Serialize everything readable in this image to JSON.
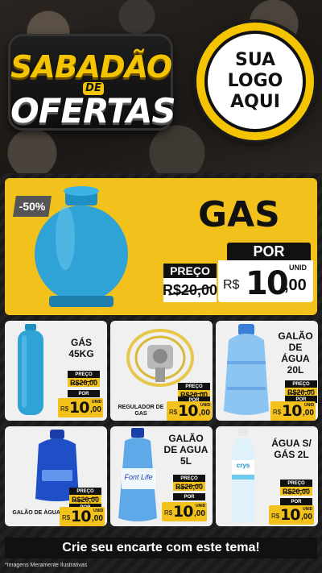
{
  "header": {
    "title_line1": "SABADÃO",
    "title_line2": "DE",
    "title_line3": "OFERTAS",
    "logo_line1": "SUA",
    "logo_line2": "LOGO",
    "logo_line3": "AQUI"
  },
  "featured": {
    "discount": "-50%",
    "name": "GAS",
    "por_label": "POR",
    "preco_label": "PREÇO",
    "old_price": "R$20,00",
    "currency": "R$",
    "price_int": "10",
    "price_cents": ",00",
    "unit": "UNID"
  },
  "products": [
    {
      "name": "GÁS 45KG",
      "preco_label": "PREÇO",
      "old_price": "R$20,00",
      "por_label": "POR",
      "currency": "R$",
      "price_int": "10",
      "price_cents": ",00",
      "unit": "UNID"
    },
    {
      "name": "REGULADOR DE GAS",
      "preco_label": "PREÇO",
      "old_price": "R$20,00",
      "por_label": "POR",
      "currency": "R$",
      "price_int": "10",
      "price_cents": ",00",
      "unit": "UNID"
    },
    {
      "name": "GALÃO DE ÁGUA 20L",
      "preco_label": "PREÇO",
      "old_price": "R$20,00",
      "por_label": "POR",
      "currency": "R$",
      "price_int": "10",
      "price_cents": ",00",
      "unit": "UNID"
    },
    {
      "name": "GALÃO DE ÁGUA 10L",
      "preco_label": "PREÇO",
      "old_price": "R$20,00",
      "por_label": "POR",
      "currency": "R$",
      "price_int": "10",
      "price_cents": ",00",
      "unit": "UNID"
    },
    {
      "name": "GALÃO DE AGUA 5L",
      "preco_label": "PREÇO",
      "old_price": "R$20,00",
      "por_label": "POR",
      "currency": "R$",
      "price_int": "10",
      "price_cents": ",00",
      "unit": "UNID",
      "bottle_brand": "Font Life"
    },
    {
      "name": "ÁGUA S/ GÁS 2L",
      "preco_label": "PREÇO",
      "old_price": "R$20,00",
      "por_label": "POR",
      "currency": "R$",
      "price_int": "10",
      "price_cents": ",00",
      "unit": "UNID",
      "bottle_brand": "crys"
    }
  ],
  "footer": {
    "cta": "Crie seu encarte com este tema!",
    "disclaimer": "*Imagens Meramente Ilustrativas"
  },
  "colors": {
    "accent_yellow": "#f2c11b",
    "dark": "#111111",
    "card_bg": "#f0f0f0",
    "gas_blue": "#2fa3d6",
    "water_blue": "#2a6fd6"
  },
  "icons": [
    "gas-cylinder-image",
    "tall-gas-cylinder-image",
    "gas-regulator-image",
    "water-jug-20l-image",
    "water-jug-10l-image",
    "water-bottle-5l-image",
    "water-bottle-2l-image"
  ]
}
